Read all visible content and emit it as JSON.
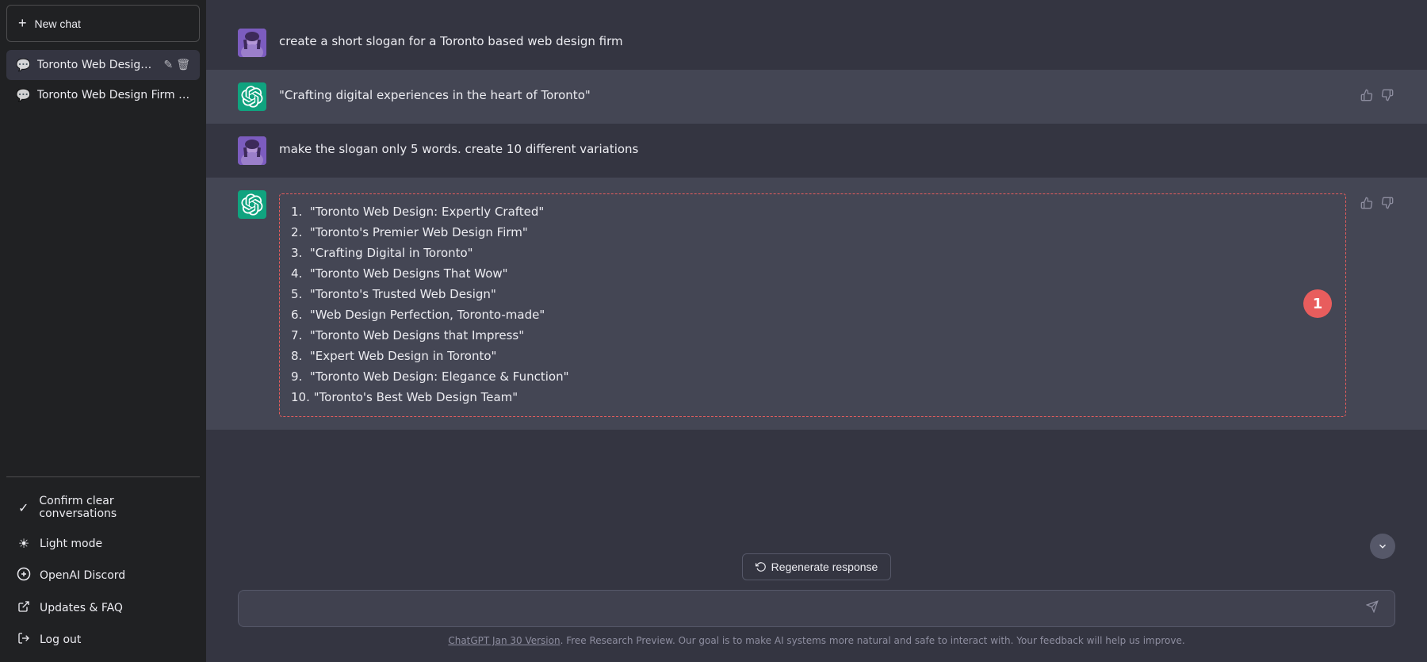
{
  "sidebar": {
    "new_chat_label": "New chat",
    "chat_items": [
      {
        "id": "chat1",
        "label": "Toronto Web Design Sl",
        "active": true,
        "show_actions": true
      },
      {
        "id": "chat2",
        "label": "Toronto Web Design Firm CTA",
        "active": false,
        "show_actions": false
      }
    ],
    "bottom_items": [
      {
        "id": "confirm-clear",
        "icon": "✓",
        "label": "Confirm clear conversations"
      },
      {
        "id": "light-mode",
        "icon": "☀",
        "label": "Light mode"
      },
      {
        "id": "discord",
        "icon": "⊕",
        "label": "OpenAI Discord"
      },
      {
        "id": "updates-faq",
        "icon": "↗",
        "label": "Updates & FAQ"
      },
      {
        "id": "logout",
        "icon": "→",
        "label": "Log out"
      }
    ]
  },
  "chat": {
    "messages": [
      {
        "id": "msg1",
        "role": "user",
        "text": "create a short slogan for a Toronto based web design firm"
      },
      {
        "id": "msg2",
        "role": "assistant",
        "text": "\"Crafting digital experiences in the heart of Toronto\""
      },
      {
        "id": "msg3",
        "role": "user",
        "text": "make the slogan only 5 words. create 10 different variations"
      },
      {
        "id": "msg4",
        "role": "assistant",
        "is_list": true,
        "items": [
          "\"Toronto Web Design: Expertly Crafted\"",
          "\"Toronto's Premier Web Design Firm\"",
          "\"Crafting Digital in Toronto\"",
          "\"Toronto Web Designs That Wow\"",
          "\"Toronto's Trusted Web Design\"",
          "\"Web Design Perfection, Toronto-made\"",
          "\"Toronto Web Designs that Impress\"",
          "\"Expert Web Design in Toronto\"",
          "\"Toronto Web Design: Elegance & Function\"",
          "\"Toronto's Best Web Design Team\""
        ],
        "badge": "1"
      }
    ],
    "regenerate_label": "Regenerate response",
    "input_placeholder": "",
    "footer_link_text": "ChatGPT Jan 30 Version",
    "footer_text": ". Free Research Preview. Our goal is to make AI systems more natural and safe to interact with. Your feedback will help us improve."
  },
  "icons": {
    "plus": "+",
    "chat_bubble": "🗨",
    "pencil": "✎",
    "trash": "🗑",
    "thumbs_up": "👍",
    "thumbs_down": "👎",
    "regenerate": "↺",
    "send": "➤",
    "scroll_down": "↓",
    "checkmark": "✓",
    "sun": "☀",
    "discord_circle": "⊕",
    "external_link": "↗",
    "logout_arrow": "⬡"
  }
}
